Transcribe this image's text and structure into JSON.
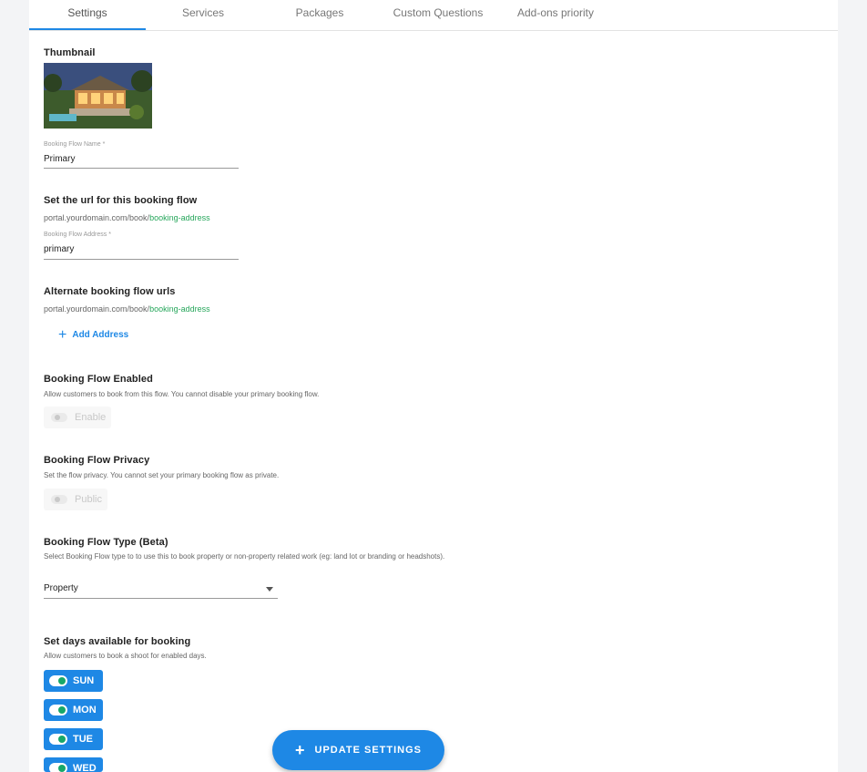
{
  "tabs": [
    {
      "label": "Settings"
    },
    {
      "label": "Services"
    },
    {
      "label": "Packages"
    },
    {
      "label": "Custom Questions"
    },
    {
      "label": "Add-ons priority"
    }
  ],
  "thumbnail": {
    "title": "Thumbnail"
  },
  "flow_name": {
    "label": "Booking Flow Name *",
    "value": "Primary"
  },
  "url_section": {
    "title": "Set the url for this booking flow",
    "prefix": "portal.yourdomain.com/book/",
    "suffix": "booking-address",
    "address_label": "Booking Flow Address *",
    "address_value": "primary"
  },
  "alternate": {
    "title": "Alternate booking flow urls",
    "prefix": "portal.yourdomain.com/book/",
    "suffix": "booking-address",
    "add_label": "Add Address",
    "add_icon": "+"
  },
  "enabled": {
    "title": "Booking Flow Enabled",
    "hint": "Allow customers to book from this flow. You cannot disable your primary booking flow.",
    "toggle_label": "Enable"
  },
  "privacy": {
    "title": "Booking Flow Privacy",
    "hint": "Set the flow privacy. You cannot set your primary booking flow as private.",
    "toggle_label": "Public"
  },
  "flow_type": {
    "title": "Booking Flow Type (Beta)",
    "hint": "Select Booking Flow type to to use this to book property or non-property related work (eg: land lot or branding or headshots).",
    "selected": "Property"
  },
  "days": {
    "title": "Set days available for booking",
    "hint": "Allow customers to book a shoot for enabled days.",
    "items": [
      {
        "label": "SUN"
      },
      {
        "label": "MON"
      },
      {
        "label": "TUE"
      },
      {
        "label": "WED"
      }
    ]
  },
  "fab": {
    "label": "UPDATE SETTINGS",
    "icon": "+"
  },
  "colors": {
    "accent": "#1e88e5",
    "green": "#26a65b",
    "toggle_on": "#17a86a"
  }
}
